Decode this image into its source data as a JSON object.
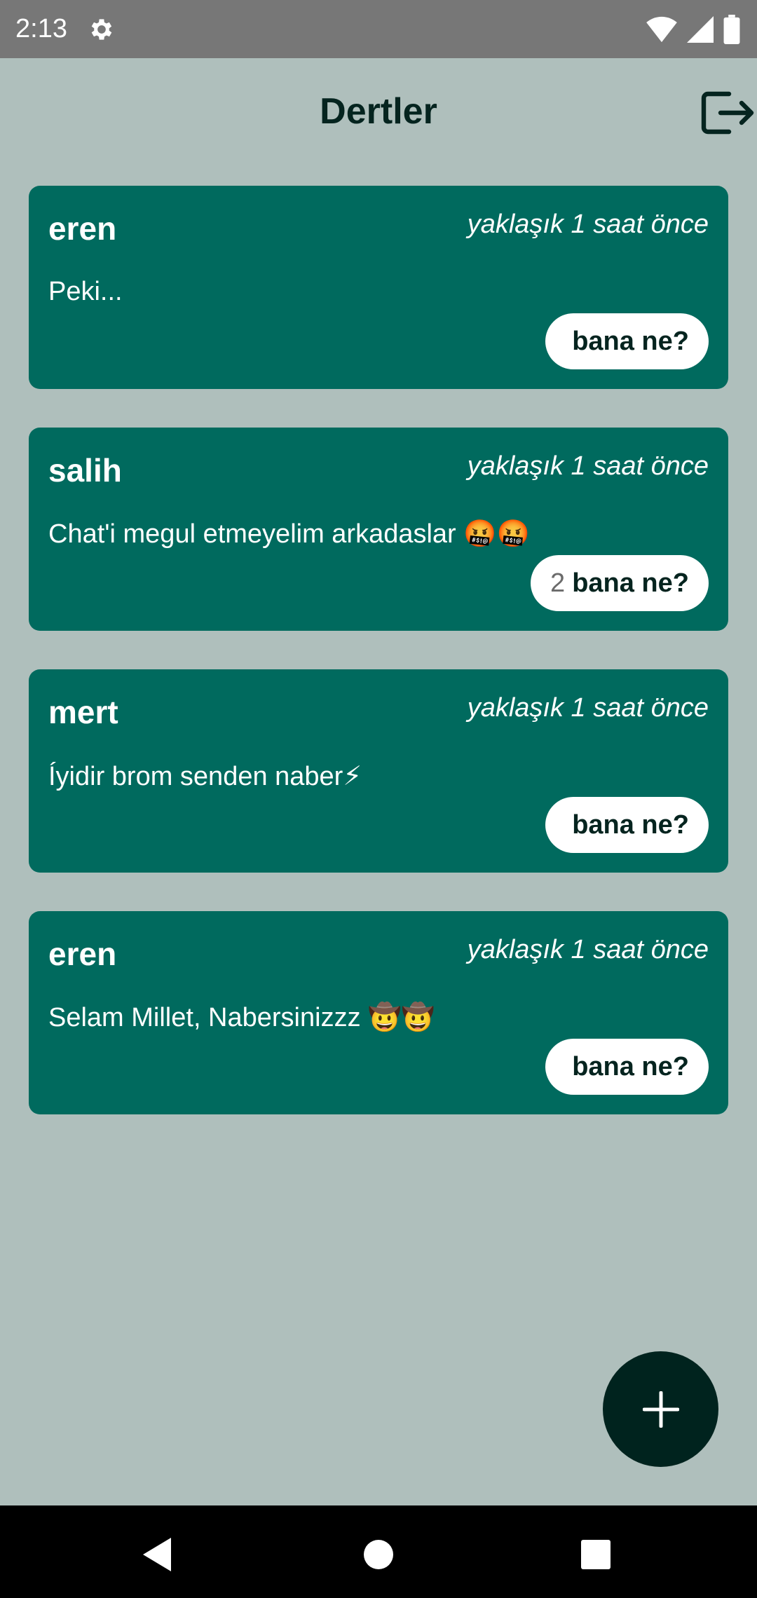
{
  "status_bar": {
    "time": "2:13",
    "icons": [
      "settings-icon",
      "wifi-icon",
      "signal-icon",
      "battery-icon"
    ]
  },
  "app_bar": {
    "title": "Dertler",
    "logout_icon": "logout-icon"
  },
  "posts": [
    {
      "username": "eren",
      "time": "yaklaşık 1 saat önce",
      "message": "Peki...",
      "reaction_count": "",
      "reaction_label": "bana ne?"
    },
    {
      "username": "salih",
      "time": "yaklaşık 1 saat önce",
      "message": "Chat'i megul etmeyelim arkadaslar 🤬🤬",
      "reaction_count": "2",
      "reaction_label": "bana ne?"
    },
    {
      "username": "mert",
      "time": "yaklaşık 1 saat önce",
      "message": "Íyidir brom senden naber⚡",
      "reaction_count": "",
      "reaction_label": "bana ne?"
    },
    {
      "username": "eren",
      "time": "yaklaşık 1 saat önce",
      "message": "Selam Millet, Nabersinizzz 🤠🤠",
      "reaction_count": "",
      "reaction_label": "bana ne?"
    }
  ],
  "fab": {
    "icon": "plus-icon"
  },
  "nav_bar": {
    "icons": [
      "back-icon",
      "home-icon",
      "recents-icon"
    ]
  },
  "colors": {
    "background": "#afbfbc",
    "card": "#006a5e",
    "fab": "#00231e",
    "title": "#05241f"
  }
}
